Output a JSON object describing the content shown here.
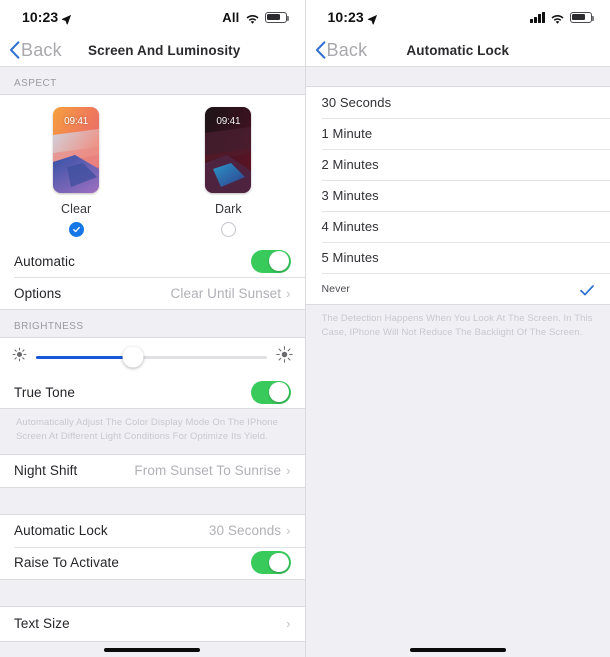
{
  "left": {
    "status": {
      "time": "10:23",
      "carrier": "All",
      "location_icon": "location-arrow-icon",
      "wifi_icon": "wifi-icon",
      "battery_icon": "battery-icon"
    },
    "nav": {
      "back_label": "Back",
      "title": "Screen And Luminosity"
    },
    "aspect": {
      "header": "ASPECT",
      "options": [
        {
          "name": "Clear",
          "clock": "09:41",
          "selected": true
        },
        {
          "name": "Dark",
          "clock": "09:41",
          "selected": false
        }
      ],
      "automatic_label": "Automatic",
      "automatic_on": true,
      "options_label": "Options",
      "options_value": "Clear Until Sunset",
      "chevron": "›"
    },
    "brightness": {
      "header": "BRIGHTNESS",
      "level_percent": 42,
      "low_icon": "sun-low-icon",
      "high_icon": "sun-high-icon",
      "true_tone_label": "True Tone",
      "true_tone_on": true,
      "true_tone_footnote": "Automatically Adjust The Color Display Mode On The IPhone Screen At Different Light Conditions For Optimize Its Yield.",
      "night_shift_label": "Night Shift",
      "night_shift_value": "From Sunset To Sunrise",
      "chevron": "›"
    },
    "lock": {
      "auto_lock_label": "Automatic Lock",
      "auto_lock_value": "30 Seconds",
      "raise_label": "Raise To Activate",
      "raise_on": true,
      "chevron": "›"
    },
    "text": {
      "text_size_label": "Text Size",
      "chevron": "›"
    }
  },
  "right": {
    "status": {
      "time": "10:23",
      "signal_icon": "signal-bars-icon",
      "location_icon": "location-arrow-icon",
      "wifi_icon": "wifi-icon",
      "battery_icon": "battery-icon"
    },
    "nav": {
      "back_label": "Back",
      "title": "Automatic Lock"
    },
    "options": [
      {
        "label": "30 Seconds",
        "selected": false
      },
      {
        "label": "1 Minute",
        "selected": false
      },
      {
        "label": "2 Minutes",
        "selected": false
      },
      {
        "label": "3 Minutes",
        "selected": false
      },
      {
        "label": "4 Minutes",
        "selected": false
      },
      {
        "label": "5 Minutes",
        "selected": false
      },
      {
        "label": "Never",
        "selected": true
      }
    ],
    "footnote": "The Detection Happens When You Look At The Screen. In This Case, IPhone Will Not Reduce The Backlight Of The Screen."
  },
  "colors": {
    "accent_blue": "#1777e6",
    "toggle_green": "#38cb5c",
    "slider_blue": "#1a56d8",
    "group_bg": "#efeff4",
    "checkmark_blue": "#2f6fd0"
  }
}
